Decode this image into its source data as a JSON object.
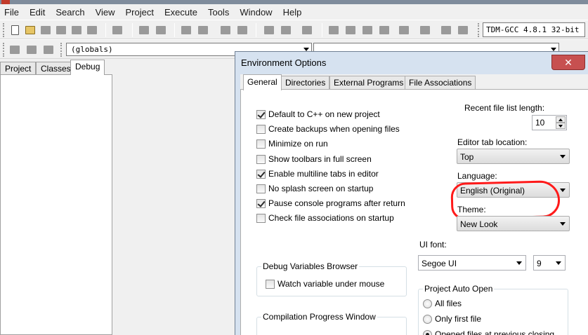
{
  "menu": [
    "File",
    "Edit",
    "Search",
    "View",
    "Project",
    "Execute",
    "Tools",
    "Window",
    "Help"
  ],
  "toolbar": {
    "compiler": "TDM-GCC 4.8.1 32-bit",
    "scope": "(globals)"
  },
  "left_tabs": [
    "Project",
    "Classes",
    "Debug"
  ],
  "dialog": {
    "title": "Environment Options",
    "close": "✕",
    "tabs": [
      "General",
      "Directories",
      "External Programs",
      "File Associations"
    ],
    "checkboxes": [
      {
        "label": "Default to C++ on new project",
        "checked": true
      },
      {
        "label": "Create backups when opening files",
        "checked": false
      },
      {
        "label": "Minimize on run",
        "checked": false
      },
      {
        "label": "Show toolbars in full screen",
        "checked": false
      },
      {
        "label": "Enable multiline tabs in editor",
        "checked": true
      },
      {
        "label": "No splash screen on startup",
        "checked": false
      },
      {
        "label": "Pause console programs after return",
        "checked": true
      },
      {
        "label": "Check file associations on startup",
        "checked": false
      }
    ],
    "recent_label": "Recent file list length:",
    "recent_value": "10",
    "editor_tab_label": "Editor tab location:",
    "editor_tab_value": "Top",
    "language_label": "Language:",
    "language_value": "English (Original)",
    "theme_label": "Theme:",
    "theme_value": "New Look",
    "ui_font_label": "UI font:",
    "ui_font_value": "Segoe UI",
    "ui_font_size": "9",
    "debug_group": "Debug Variables Browser",
    "watch_label": "Watch variable under mouse",
    "compile_group": "Compilation Progress Window",
    "auto_open_group": "Project Auto Open",
    "auto_open_options": [
      {
        "label": "All files",
        "selected": false
      },
      {
        "label": "Only first file",
        "selected": false
      },
      {
        "label": "Opened files at previous closing",
        "selected": true
      }
    ]
  }
}
